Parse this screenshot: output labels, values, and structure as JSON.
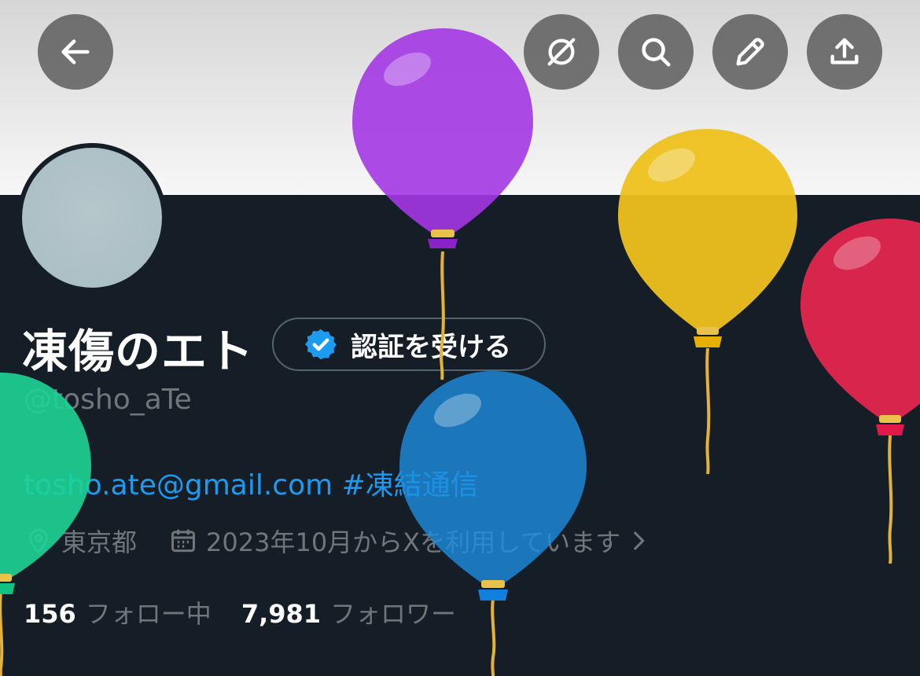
{
  "header": {
    "buttons": [
      {
        "name": "back-button",
        "icon": "arrow-left-icon"
      },
      {
        "name": "grok-button",
        "icon": "grok-icon"
      },
      {
        "name": "search-button",
        "icon": "search-icon"
      },
      {
        "name": "edit-button",
        "icon": "pencil-icon"
      },
      {
        "name": "share-button",
        "icon": "share-icon"
      }
    ]
  },
  "profile": {
    "display_name": "凍傷のエト",
    "verify_button_label": "認証を受ける",
    "handle": "@tosho_aTe",
    "bio_email": "tosho.ate@gmail.com",
    "bio_hashtag": "#凍結通信",
    "location": "東京都",
    "joined": "2023年10月からXを利用しています",
    "following_count": "156",
    "following_label": "フォロー中",
    "followers_count": "7,981",
    "followers_label": "フォロワー"
  },
  "decoration": {
    "balloons": [
      {
        "name": "purple-balloon",
        "color": "#a437e4"
      },
      {
        "name": "yellow-balloon",
        "color": "#edc11e"
      },
      {
        "name": "red-balloon",
        "color": "#e2264e"
      },
      {
        "name": "blue-balloon",
        "color": "#1d8fe0"
      },
      {
        "name": "green-balloon",
        "color": "#1ed597"
      }
    ]
  },
  "colors": {
    "background": "#151d27",
    "link": "#1d9bf0",
    "muted": "#71767b",
    "verified_badge": "#1d9bf0"
  }
}
